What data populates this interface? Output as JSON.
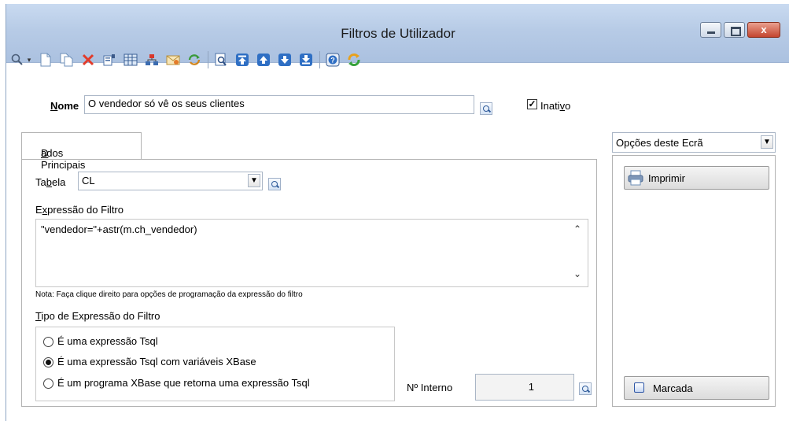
{
  "window": {
    "title": "Filtros de Utilizador",
    "controls": {
      "close": "x"
    }
  },
  "toolbar": {
    "icons": [
      "search-icon",
      "dropdown-arrow-icon",
      "new-document-icon",
      "copy-document-icon",
      "delete-icon",
      "edit-icon",
      "table-icon",
      "tree-icon",
      "mail-icon",
      "refresh-icon",
      "preview-icon",
      "first-record-icon",
      "previous-record-icon",
      "next-record-icon",
      "last-record-icon",
      "help-icon",
      "sync-icon"
    ]
  },
  "form": {
    "nome_label_u": "N",
    "nome_label_rest": "ome",
    "nome_value": "O vendedor só vê os seus clientes",
    "inativo_label_pre": "Inati",
    "inativo_label_u": "v",
    "inativo_label_post": "o",
    "inativo_checked": "✓"
  },
  "tab": {
    "label_u": "D",
    "label_rest": "ados Principais"
  },
  "panel": {
    "tabela_label_pre": "Ta",
    "tabela_label_u": "b",
    "tabela_label_post": "ela",
    "tabela_value": "CL",
    "expressao_label_pre": "E",
    "expressao_label_u": "x",
    "expressao_label_post": "pressão do Filtro",
    "expressao_value": "\"vendedor=\"+astr(m.ch_vendedor)",
    "nota": "Nota: Faça clique direito para opções de programação da expressão do filtro",
    "tipo_label_u": "T",
    "tipo_label_rest": "ipo de Expressão do Filtro",
    "tipo_options": [
      {
        "label": "É uma expressão Tsql",
        "selected": false
      },
      {
        "label": "É uma expressão Tsql com variáveis XBase",
        "selected": true
      },
      {
        "label": "É um programa XBase que retorna uma expressão Tsql",
        "selected": false
      }
    ],
    "interno_label": "Nº Interno",
    "interno_value": "1"
  },
  "side": {
    "opcoes_label": "Opções deste Ecrã",
    "imprimir": "Imprimir",
    "marcada": "Marcada"
  }
}
